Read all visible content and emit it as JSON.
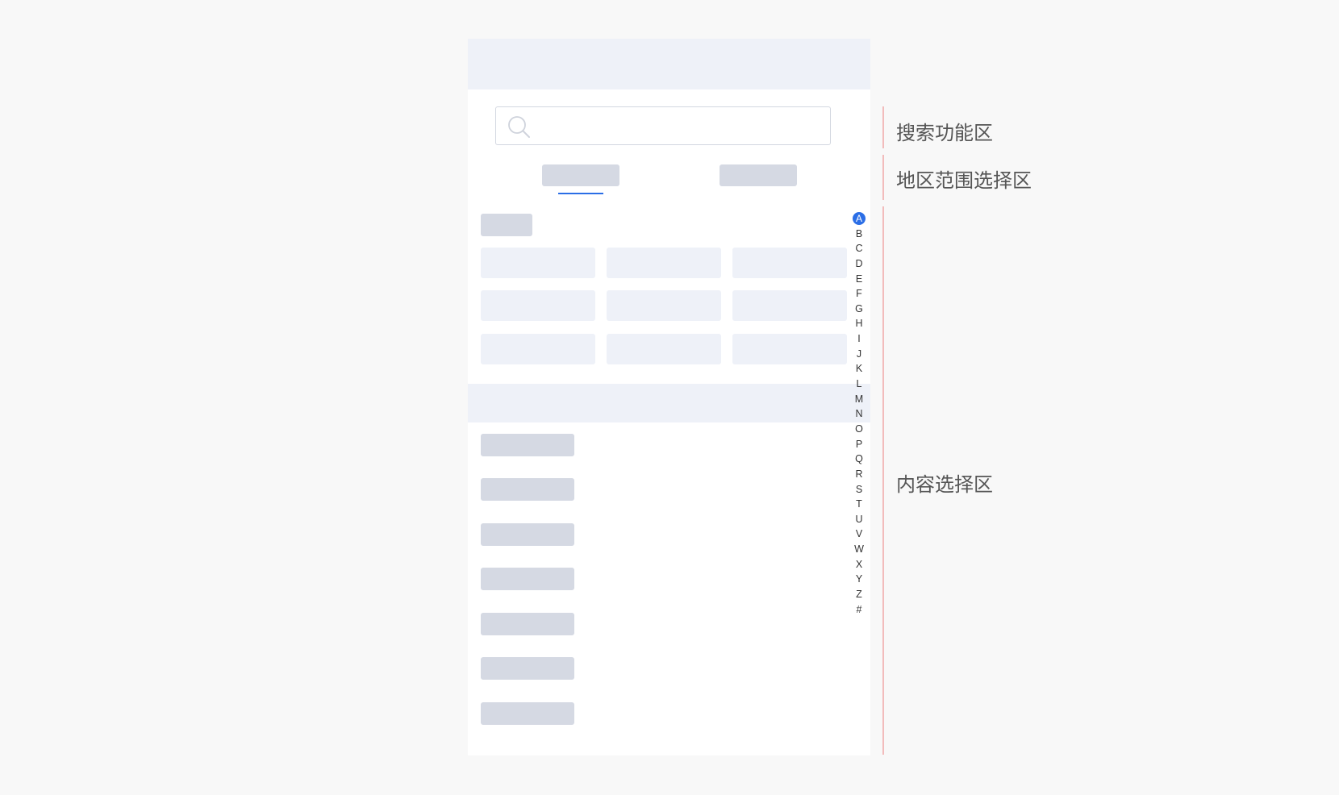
{
  "search": {
    "value": "",
    "placeholder": ""
  },
  "index": {
    "letters": [
      "A",
      "B",
      "C",
      "D",
      "E",
      "F",
      "G",
      "H",
      "I",
      "J",
      "K",
      "L",
      "M",
      "N",
      "O",
      "P",
      "Q",
      "R",
      "S",
      "T",
      "U",
      "V",
      "W",
      "X",
      "Y",
      "Z",
      "#"
    ],
    "active": "A"
  },
  "annotations": {
    "search_area": "搜索功能区",
    "region_scope_area": "地区范围选择区",
    "content_area": "内容选择区"
  },
  "colors": {
    "accent": "#2b6ee6",
    "placeholder_dark": "#d5d9e3",
    "placeholder_light": "#eef1f8",
    "annotation_line": "#f2bcbc"
  }
}
